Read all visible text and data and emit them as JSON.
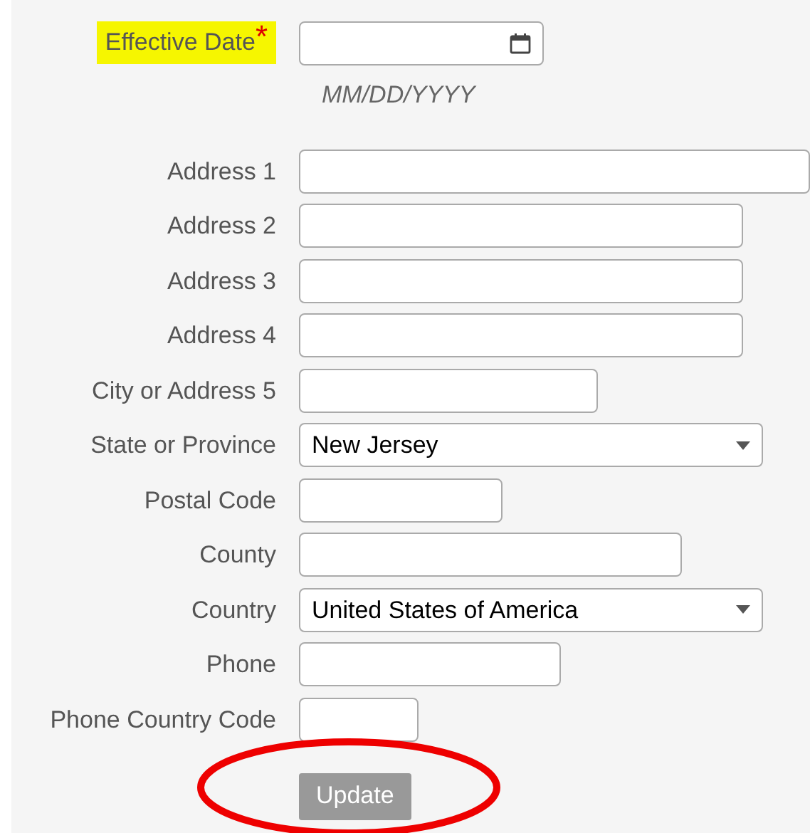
{
  "effective_date": {
    "label": "Effective Date",
    "required_mark": "*",
    "highlighted": true,
    "hint": "MM/DD/YYYY"
  },
  "fields": [
    {
      "label": "Address 1",
      "kind": "text"
    },
    {
      "label": "Address 2",
      "kind": "text"
    },
    {
      "label": "Address 3",
      "kind": "text"
    },
    {
      "label": "Address 4",
      "kind": "text"
    },
    {
      "label": "City or Address 5",
      "kind": "text"
    },
    {
      "label": "State or Province",
      "kind": "select",
      "value": "New Jersey"
    },
    {
      "label": "Postal Code",
      "kind": "text"
    },
    {
      "label": "County",
      "kind": "text"
    },
    {
      "label": "Country",
      "kind": "select",
      "value": "United States of America"
    },
    {
      "label": "Phone",
      "kind": "text"
    },
    {
      "label": "Phone Country Code",
      "kind": "text"
    }
  ],
  "update_button": {
    "label": "Update",
    "disabled": true,
    "circled": true
  }
}
